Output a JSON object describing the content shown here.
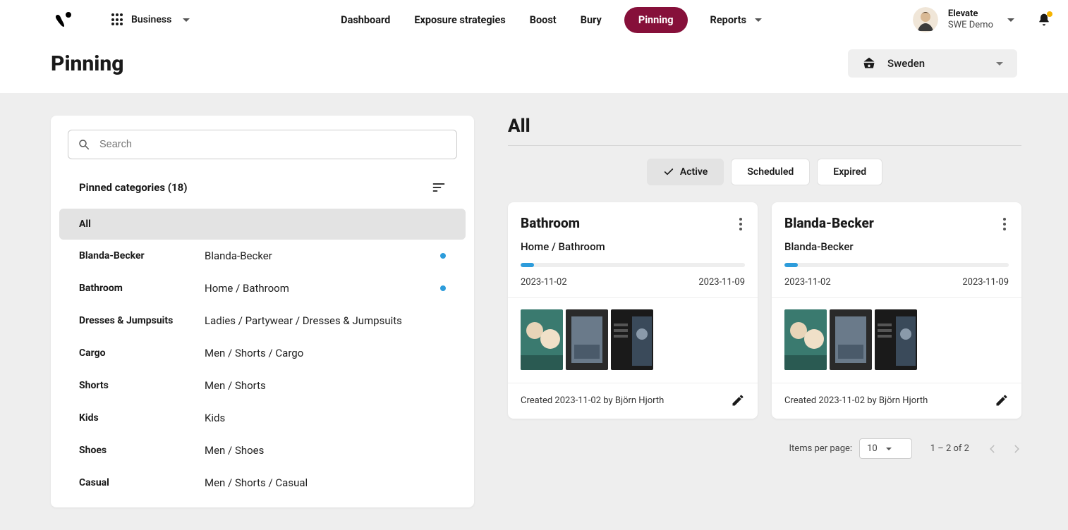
{
  "header": {
    "business_label": "Business",
    "nav": {
      "dashboard": "Dashboard",
      "exposure": "Exposure strategies",
      "boost": "Boost",
      "bury": "Bury",
      "pinning": "Pinning",
      "reports": "Reports"
    },
    "account": {
      "line1": "Elevate",
      "line2": "SWE Demo"
    }
  },
  "page": {
    "title": "Pinning",
    "market": "Sweden"
  },
  "sidebar": {
    "search_placeholder": "Search",
    "list_label": "Pinned categories (18)",
    "items": [
      {
        "name": "All",
        "path": "",
        "selected": true,
        "has_dot": false
      },
      {
        "name": "Blanda-Becker",
        "path": "Blanda-Becker",
        "selected": false,
        "has_dot": true
      },
      {
        "name": "Bathroom",
        "path": "Home / Bathroom",
        "selected": false,
        "has_dot": true
      },
      {
        "name": "Dresses & Jumpsuits",
        "path": "Ladies / Partywear / Dresses & Jumpsuits",
        "selected": false,
        "has_dot": false
      },
      {
        "name": "Cargo",
        "path": "Men / Shorts / Cargo",
        "selected": false,
        "has_dot": false
      },
      {
        "name": "Shorts",
        "path": "Men / Shorts",
        "selected": false,
        "has_dot": false
      },
      {
        "name": "Kids",
        "path": "Kids",
        "selected": false,
        "has_dot": false
      },
      {
        "name": "Shoes",
        "path": "Men / Shoes",
        "selected": false,
        "has_dot": false
      },
      {
        "name": "Casual",
        "path": "Men / Shorts / Casual",
        "selected": false,
        "has_dot": false
      }
    ]
  },
  "main": {
    "title": "All",
    "tabs": {
      "active": "Active",
      "scheduled": "Scheduled",
      "expired": "Expired"
    },
    "cards": [
      {
        "title": "Bathroom",
        "path": "Home / Bathroom",
        "start_date": "2023-11-02",
        "end_date": "2023-11-09",
        "progress_pct": 6,
        "footer": "Created 2023-11-02 by Björn Hjorth"
      },
      {
        "title": "Blanda-Becker",
        "path": "Blanda-Becker",
        "start_date": "2023-11-02",
        "end_date": "2023-11-09",
        "progress_pct": 6,
        "footer": "Created 2023-11-02 by Björn Hjorth"
      }
    ],
    "pagination": {
      "items_label": "Items per page:",
      "per_page": "10",
      "range": "1 – 2 of 2"
    }
  }
}
